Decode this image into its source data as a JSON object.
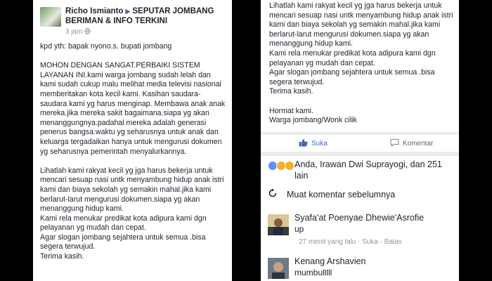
{
  "left_post": {
    "author": "Richo Ismianto",
    "author_separator": "▶",
    "group_name": "SEPUTAR JOMBANG BERIMAN & INFO TERKINI",
    "timestamp": "3 jam",
    "privacy_icon": "globe-icon",
    "body": "kpd yth: bapak nyono.s. bupati jombang\n\nMOHON DENGAN SANGAT.PERBAIKI SISTEM LAYANAN INI.kami warga jombang sudah lelah dan kami sudah cukup malu melihat media televisi nasional memberitakan kota kecil kami. Kasihan saudara-saudara kami yg harus menginap. Membawa anak anak mereka.jika mereka sakit bagaimana.siapa yg akan menanggungnya.padahal mereka adalah generasi penerus bangsa.waktu yg seharusnya untuk anak dan keluarga tergadaikan hanya untuk mengurusi dokumen yg seharusnya pemerintah menyalurkannya.\n\nLihatlah kami rakyat kecil yg jga harus bekerja untuk mencari sesuap nasi untk menyambung hidup anak istri kami dan biaya sekolah yg semakin mahal.jika kami berlarut-larut mengurusi dokumen.siapa yg akan menanggung hidup kami.\nKami rela menukar predikat kota adipura kami dgn pelayanan yg mudah dan cepat.\nAgar slogan jombang sejahtera untuk semua .bisa segera terwujud.\nTerima kasih."
  },
  "right_post": {
    "body": "Lihatlah kami rakyat kecil yg jga harus bekerja untuk mencari sesuap nasi untk menyambung hidup anak istri kami dan biaya sekolah yg semakin mahal.jika kami berlarut-larut mengurusi dokumen.siapa yg akan menanggung hidup kami.\nKami rela menukar predikat kota adipura kami dgn pelayanan yg mudah dan cepat.\nAgar slogan jombang sejahtera untuk semua .bisa segera terwujud.\nTerima kasih.\n\nHormat kami.\nWarga jombang/Wonk cilik",
    "like_label": "Suka",
    "comment_label": "Komentar",
    "reactions_text": "Anda, Irawan Dwi Suprayogi, dan 251 lain",
    "prev_comments_label": "Muat komentar sebelumnya",
    "comments": [
      {
        "name": "Syafa'at Poenyae Dhewie'Asrofie",
        "text": "up",
        "time": "27 menit yang lalu",
        "like": "Suka",
        "reply": "Balas",
        "separator": "·"
      },
      {
        "name": "Kenang Arshavien",
        "text": "mumbulllll"
      }
    ]
  },
  "colors": {
    "like_blue": "#4267b2",
    "reaction_like": "#5890ff",
    "reaction_wow": "#f7b125",
    "reaction_sad": "#f7b125",
    "muted_text": "#90949c",
    "background": "#000000"
  }
}
